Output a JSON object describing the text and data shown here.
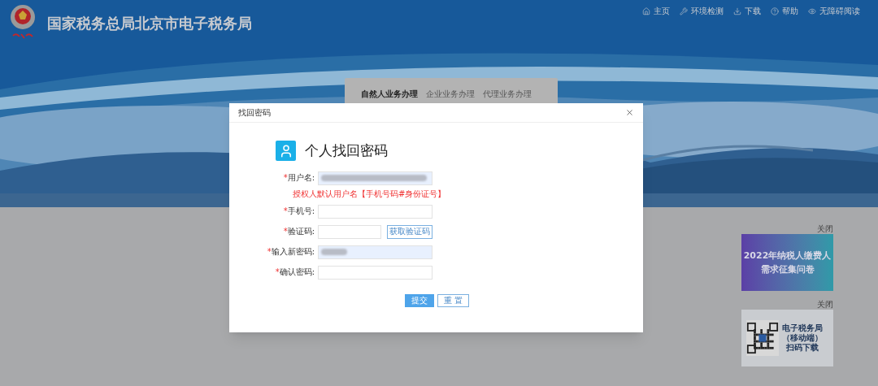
{
  "header": {
    "title": "国家税务总局北京市电子税务局"
  },
  "nav": [
    {
      "label": "主页",
      "kind": "home"
    },
    {
      "label": "环境检测",
      "kind": "wrench"
    },
    {
      "label": "下载",
      "kind": "download"
    },
    {
      "label": "帮助",
      "kind": "help"
    },
    {
      "label": "无障碍阅读",
      "kind": "eye"
    }
  ],
  "login_tabs": [
    {
      "label": "自然人业务办理",
      "selected": true
    },
    {
      "label": "企业业务办理",
      "selected": false
    },
    {
      "label": "代理业务办理",
      "selected": false
    }
  ],
  "dialog": {
    "title": "找回密码",
    "heading": "个人找回密码",
    "fields": [
      {
        "label": "用户名:",
        "kind": "masked",
        "hint": "授权人默认用户名【手机号码#身份证号】"
      },
      {
        "label": "手机号:",
        "kind": "text"
      },
      {
        "label": "验证码:",
        "kind": "code",
        "button": "获取验证码"
      },
      {
        "label": "输入新密码:",
        "kind": "masked"
      },
      {
        "label": "确认密码:",
        "kind": "text"
      }
    ],
    "required_mark": "*",
    "submit": "提交",
    "reset": "重 置"
  },
  "ads": [
    {
      "close": "关闭",
      "kind": "survey",
      "lines": [
        "2022年纳税人缴费人",
        "需求征集问卷"
      ]
    },
    {
      "close": "关闭",
      "kind": "qr",
      "lines": [
        "电子税务局",
        "（移动端）",
        "扫码下载"
      ]
    }
  ]
}
